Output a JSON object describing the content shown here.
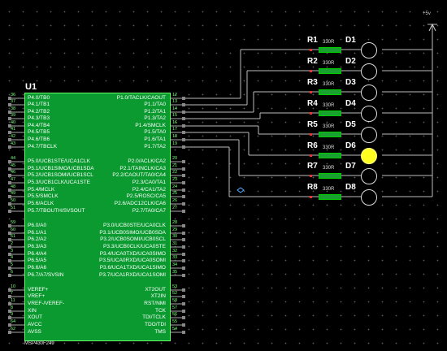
{
  "vcc": "+5v",
  "mcu": {
    "ref": "U1",
    "part": "MSP430F249",
    "left_pins": [
      {
        "num": "36",
        "name": "P4.0/TB0"
      },
      {
        "num": "37",
        "name": "P4.1/TB1"
      },
      {
        "num": "38",
        "name": "P4.2/TB2"
      },
      {
        "num": "39",
        "name": "P4.3/TB3"
      },
      {
        "num": "40",
        "name": "P4.4/TB4"
      },
      {
        "num": "41",
        "name": "P4.5/TB5"
      },
      {
        "num": "42",
        "name": "P4.6/TB6"
      },
      {
        "num": "43",
        "name": "P4.7/TBCLK"
      },
      {
        "num": "44",
        "name": "P5.0/UCB1STE/UCA1CLK"
      },
      {
        "num": "45",
        "name": "P5.1/UCB1SIMO/UCB1SDA"
      },
      {
        "num": "46",
        "name": "P5.2/UCB1SOMI/UCB1SCL"
      },
      {
        "num": "47",
        "name": "P5.3/UCB1CLK/UCA1STE"
      },
      {
        "num": "48",
        "name": "P5.4/MCLK"
      },
      {
        "num": "49",
        "name": "P5.5/SMCLK"
      },
      {
        "num": "50",
        "name": "P5.6/ACLK"
      },
      {
        "num": "51",
        "name": "P5.7/TBOUTH/SVSOUT"
      },
      {
        "num": "59",
        "name": "P6.0/A0"
      },
      {
        "num": "60",
        "name": "P6.1/A1"
      },
      {
        "num": "61",
        "name": "P6.2/A2"
      },
      {
        "num": "2",
        "name": "P6.3/A3"
      },
      {
        "num": "3",
        "name": "P6.4/A4"
      },
      {
        "num": "4",
        "name": "P6.5/A5"
      },
      {
        "num": "5",
        "name": "P6.6/A6"
      },
      {
        "num": "6",
        "name": "P6.7/A7/SVSIN"
      },
      {
        "num": "10",
        "name": "VEREF+"
      },
      {
        "num": "7",
        "name": "VREF+"
      },
      {
        "num": "11",
        "name": "VREF-/VEREF-"
      },
      {
        "num": "8",
        "name": "XIN"
      },
      {
        "num": "9",
        "name": "XOUT"
      },
      {
        "num": "64",
        "name": "AVCC"
      },
      {
        "num": "62",
        "name": "AVSS"
      }
    ],
    "right_pins": [
      {
        "num": "12",
        "name": "P1.0/TACLK/CAOUT"
      },
      {
        "num": "13",
        "name": "P1.1/TA0"
      },
      {
        "num": "14",
        "name": "P1.2/TA1"
      },
      {
        "num": "15",
        "name": "P1.3/TA2"
      },
      {
        "num": "16",
        "name": "P1.4/SMCLK"
      },
      {
        "num": "17",
        "name": "P1.5/TA0"
      },
      {
        "num": "18",
        "name": "P1.6/TA1"
      },
      {
        "num": "19",
        "name": "P1.7/TA2"
      },
      {
        "num": "20",
        "name": "P2.0/ACLK/CA2"
      },
      {
        "num": "21",
        "name": "P2.1/TAINCLK/CA3"
      },
      {
        "num": "22",
        "name": "P2.2/CAOUT/TA0/CA4"
      },
      {
        "num": "23",
        "name": "P2.3/CA0/TA1"
      },
      {
        "num": "24",
        "name": "P2.4/CA1/TA2"
      },
      {
        "num": "25",
        "name": "P2.5/ROSC/CA5"
      },
      {
        "num": "26",
        "name": "P2.6/ADC12CLK/CA6"
      },
      {
        "num": "27",
        "name": "P2.7/TA0/CA7"
      },
      {
        "num": "28",
        "name": "P3.0/UCB0STE/UCA0CLK"
      },
      {
        "num": "29",
        "name": "P3.1/UCB0SIMO/UCB0SDA"
      },
      {
        "num": "30",
        "name": "P3.2/UCB0SOMI/UCB0SCL"
      },
      {
        "num": "31",
        "name": "P3.3/UCB0CLK/UCA0STE"
      },
      {
        "num": "32",
        "name": "P3.4/UCA0TXD/UCA0SIMO"
      },
      {
        "num": "33",
        "name": "P3.5/UCA0RXD/UCA0SOMI"
      },
      {
        "num": "34",
        "name": "P3.6/UCA1TXD/UCA1SIMO"
      },
      {
        "num": "35",
        "name": "P3.7/UCA1RXD/UCA1SOMI"
      },
      {
        "num": "53",
        "name": "XT2OUT"
      },
      {
        "num": "52",
        "name": "XT2IN"
      },
      {
        "num": "58",
        "name": "RST/NMI"
      },
      {
        "num": "57",
        "name": "TCK"
      },
      {
        "num": "56",
        "name": "TDI/TCLK"
      },
      {
        "num": "55",
        "name": "TDO/TDI"
      },
      {
        "num": "54",
        "name": "TMS"
      }
    ]
  },
  "resistors": [
    {
      "ref": "R1",
      "value": "330R"
    },
    {
      "ref": "R2",
      "value": "330R"
    },
    {
      "ref": "R3",
      "value": "330R"
    },
    {
      "ref": "R4",
      "value": "330R"
    },
    {
      "ref": "R5",
      "value": "330R"
    },
    {
      "ref": "R6",
      "value": "330R"
    },
    {
      "ref": "R7",
      "value": "330R"
    },
    {
      "ref": "R8",
      "value": "330R"
    }
  ],
  "leds": [
    {
      "ref": "D1",
      "lit": false
    },
    {
      "ref": "D2",
      "lit": false
    },
    {
      "ref": "D3",
      "lit": false
    },
    {
      "ref": "D4",
      "lit": false
    },
    {
      "ref": "D5",
      "lit": false
    },
    {
      "ref": "D6",
      "lit": true
    },
    {
      "ref": "D7",
      "lit": false
    },
    {
      "ref": "D8",
      "lit": false
    }
  ],
  "colors": {
    "background": "#000000",
    "chip_body": "#0a9a30",
    "wire": "#bbbbbb",
    "resistor": "#1aa030",
    "led_on": "#ffff22"
  }
}
